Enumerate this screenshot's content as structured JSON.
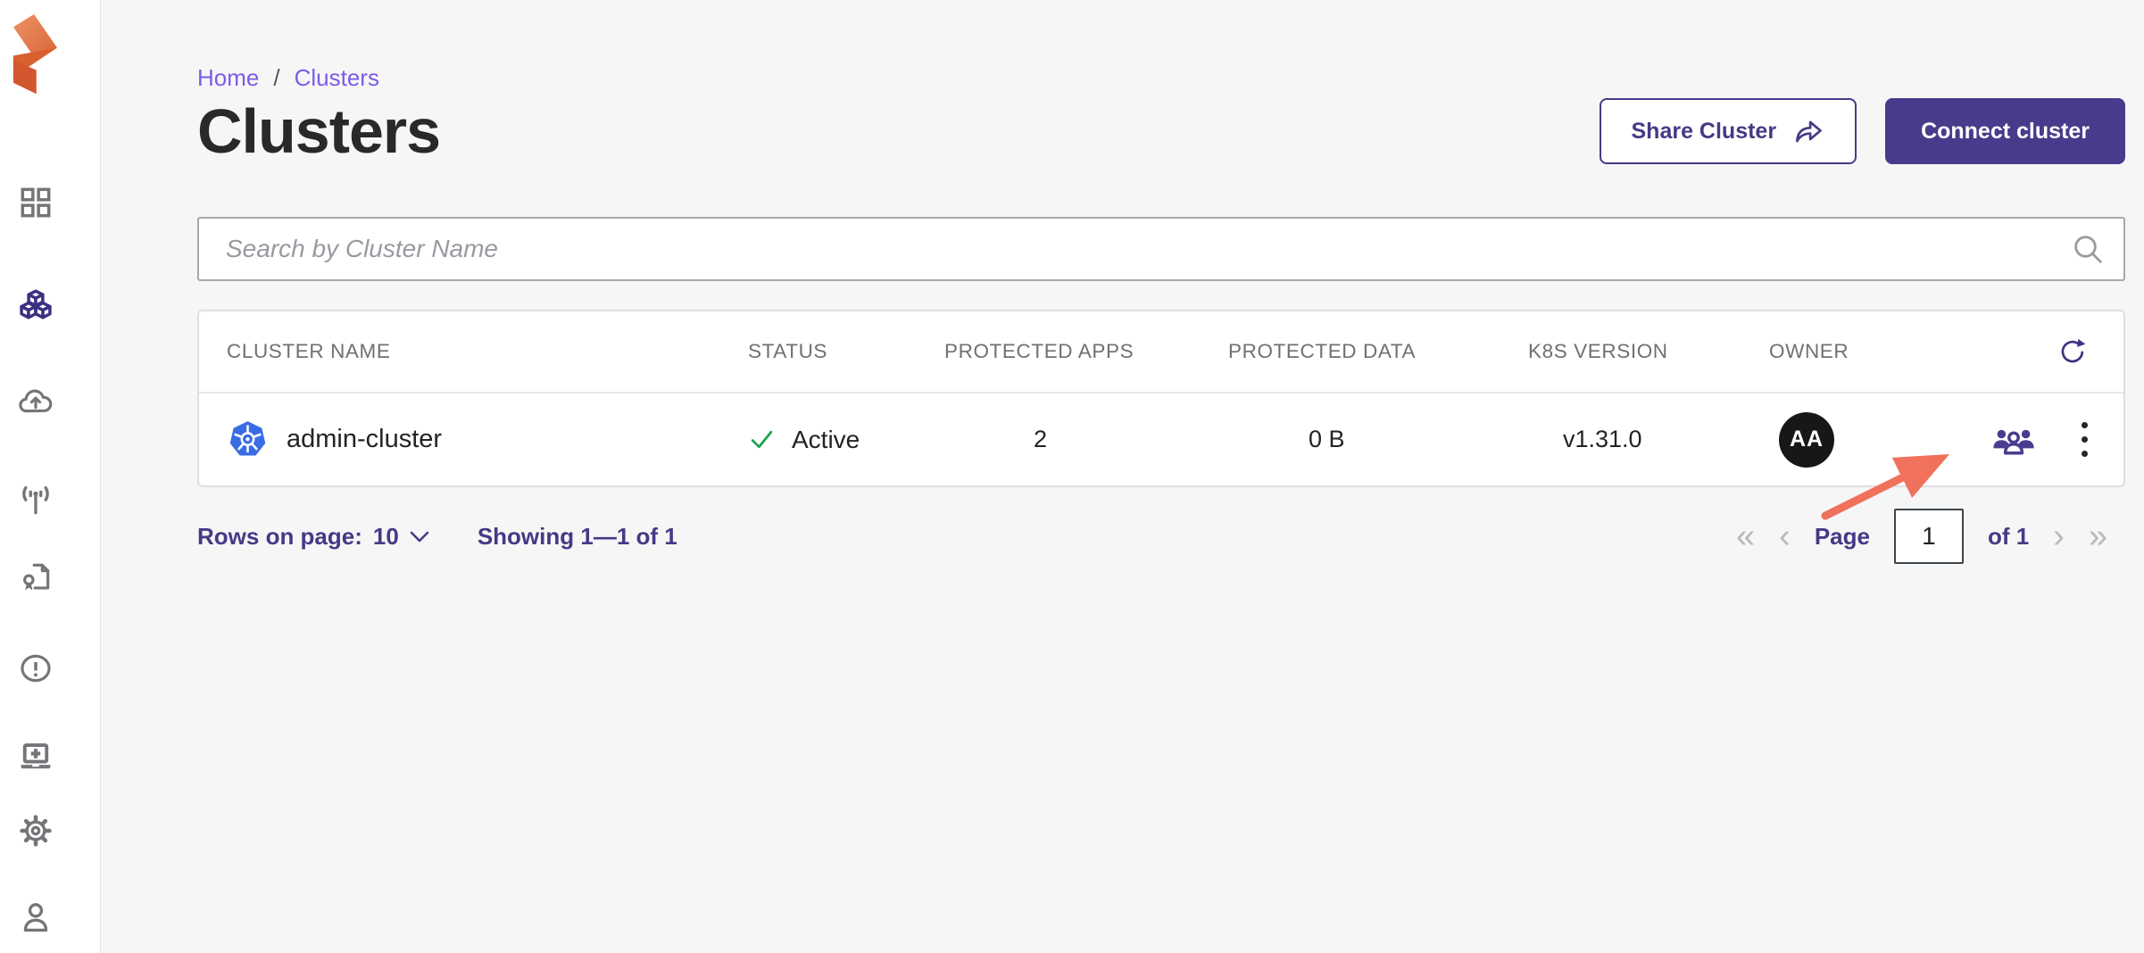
{
  "app": {
    "name": "Portworx console",
    "logo_icon": "portworx-logo-icon"
  },
  "sidebar": {
    "items": [
      {
        "id": "dashboard",
        "icon": "grid-icon",
        "active": false
      },
      {
        "id": "clusters",
        "icon": "cubes-icon",
        "active": true
      },
      {
        "id": "cloud-backup",
        "icon": "cloud-upload-icon",
        "active": false
      },
      {
        "id": "broadcast",
        "icon": "antenna-icon",
        "active": false
      },
      {
        "id": "licenses",
        "icon": "certificate-file-icon",
        "active": false
      },
      {
        "id": "alerts",
        "icon": "alert-circle-icon",
        "active": false
      },
      {
        "id": "install",
        "icon": "laptop-plus-icon",
        "active": false
      },
      {
        "id": "settings",
        "icon": "gear-icon",
        "active": false
      },
      {
        "id": "profile",
        "icon": "user-icon",
        "active": false
      }
    ]
  },
  "breadcrumb": {
    "home_label": "Home",
    "separator": "/",
    "current_label": "Clusters"
  },
  "page": {
    "title": "Clusters"
  },
  "header_actions": {
    "share_label": "Share Cluster",
    "share_icon": "share-arrow-icon",
    "connect_label": "Connect cluster"
  },
  "search": {
    "placeholder": "Search by Cluster Name",
    "icon": "search-icon"
  },
  "table": {
    "columns": [
      "CLUSTER NAME",
      "STATUS",
      "PROTECTED APPS",
      "PROTECTED DATA",
      "K8S VERSION",
      "OWNER"
    ],
    "refresh_icon": "refresh-icon",
    "rows": [
      {
        "cluster_icon": "kubernetes-icon",
        "name": "admin-cluster",
        "status": "Active",
        "status_icon": "check-icon",
        "protected_apps": "2",
        "protected_data": "0 B",
        "k8s_version": "v1.31.0",
        "owner_initials": "AA",
        "row_icons": [
          "group-users-icon",
          "kebab-menu-icon"
        ]
      }
    ]
  },
  "pagination": {
    "rows_on_page_label": "Rows on page:",
    "rows_on_page_value": "10",
    "showing_text": "Showing 1—1 of 1",
    "first_icon": "«",
    "prev_icon": "‹",
    "page_label": "Page",
    "page_value": "1",
    "of_label": "of 1",
    "next_icon": "›",
    "last_icon": "»"
  },
  "annotation": {
    "type": "arrow",
    "color": "#f0715c",
    "points_to": "group-users-icon"
  },
  "colors": {
    "accent_indigo": "#453a86",
    "button_indigo": "#473c8b",
    "link_purple": "#7c5ce6",
    "success_green": "#18a24e",
    "kubernetes_blue": "#3a6de4",
    "arrow_red": "#f0715c",
    "avatar_bg": "#17171a",
    "background": "#f6f6f7"
  }
}
